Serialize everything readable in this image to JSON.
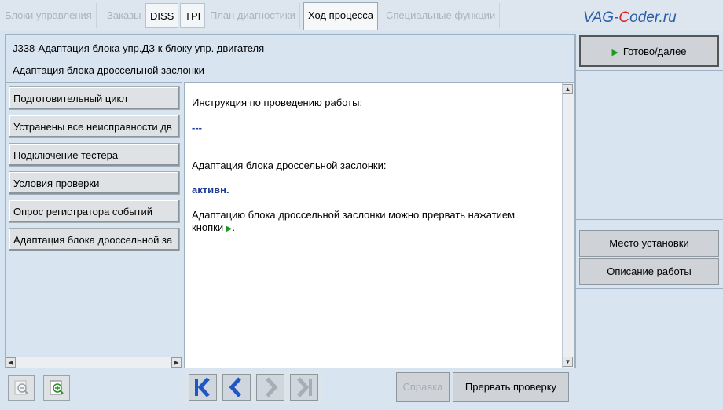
{
  "tabs": [
    {
      "label": "Блоки управления",
      "state": "disabled"
    },
    {
      "label": "Заказы",
      "state": "disabled"
    },
    {
      "label": "DISS",
      "state": "enabled"
    },
    {
      "label": "TPI",
      "state": "enabled"
    },
    {
      "label": "План диагностики",
      "state": "disabled"
    },
    {
      "label": "Ход процесса",
      "state": "active"
    },
    {
      "label": "Специальные функции",
      "state": "disabled"
    }
  ],
  "watermark": {
    "prefix": "VAG-",
    "accent": "C",
    "suffix": "oder.ru"
  },
  "header": {
    "title": "J338-Адаптация блока упр.ДЗ к блоку упр. двигателя",
    "subtitle": "Адаптация блока дроссельной заслонки"
  },
  "steps": [
    "Подготовительный цикл",
    "Устранены все неисправности дв",
    "Подключение тестера",
    "Условия проверки",
    "Опрос регистратора событий",
    "Адаптация блока дроссельной за"
  ],
  "content": {
    "instruction_heading": "Инструкция по проведению работы:",
    "dashes": "---",
    "adaptation_label": "Адаптация блока дроссельной заслонки:",
    "status": "активн.",
    "note_line1": "Адаптацию блока дроссельной заслонки можно прервать нажатием",
    "note_line2_prefix": "кнопки",
    "note_line2_suffix": "."
  },
  "right_panel": {
    "next_button": "Готово/далее",
    "location_button": "Место установки",
    "description_button": "Описание работы"
  },
  "bottom": {
    "help_button": "Справка",
    "abort_button": "Прервать проверку"
  },
  "colors": {
    "accent_blue": "#1d3a9a",
    "play_green": "#1c9a1c",
    "nav_blue": "#1f56c4",
    "nav_disabled": "#a5adb5"
  },
  "icons": [
    "play-icon",
    "zoom-out-icon",
    "zoom-in-icon",
    "first-page-icon",
    "previous-icon",
    "next-icon",
    "last-page-icon"
  ]
}
